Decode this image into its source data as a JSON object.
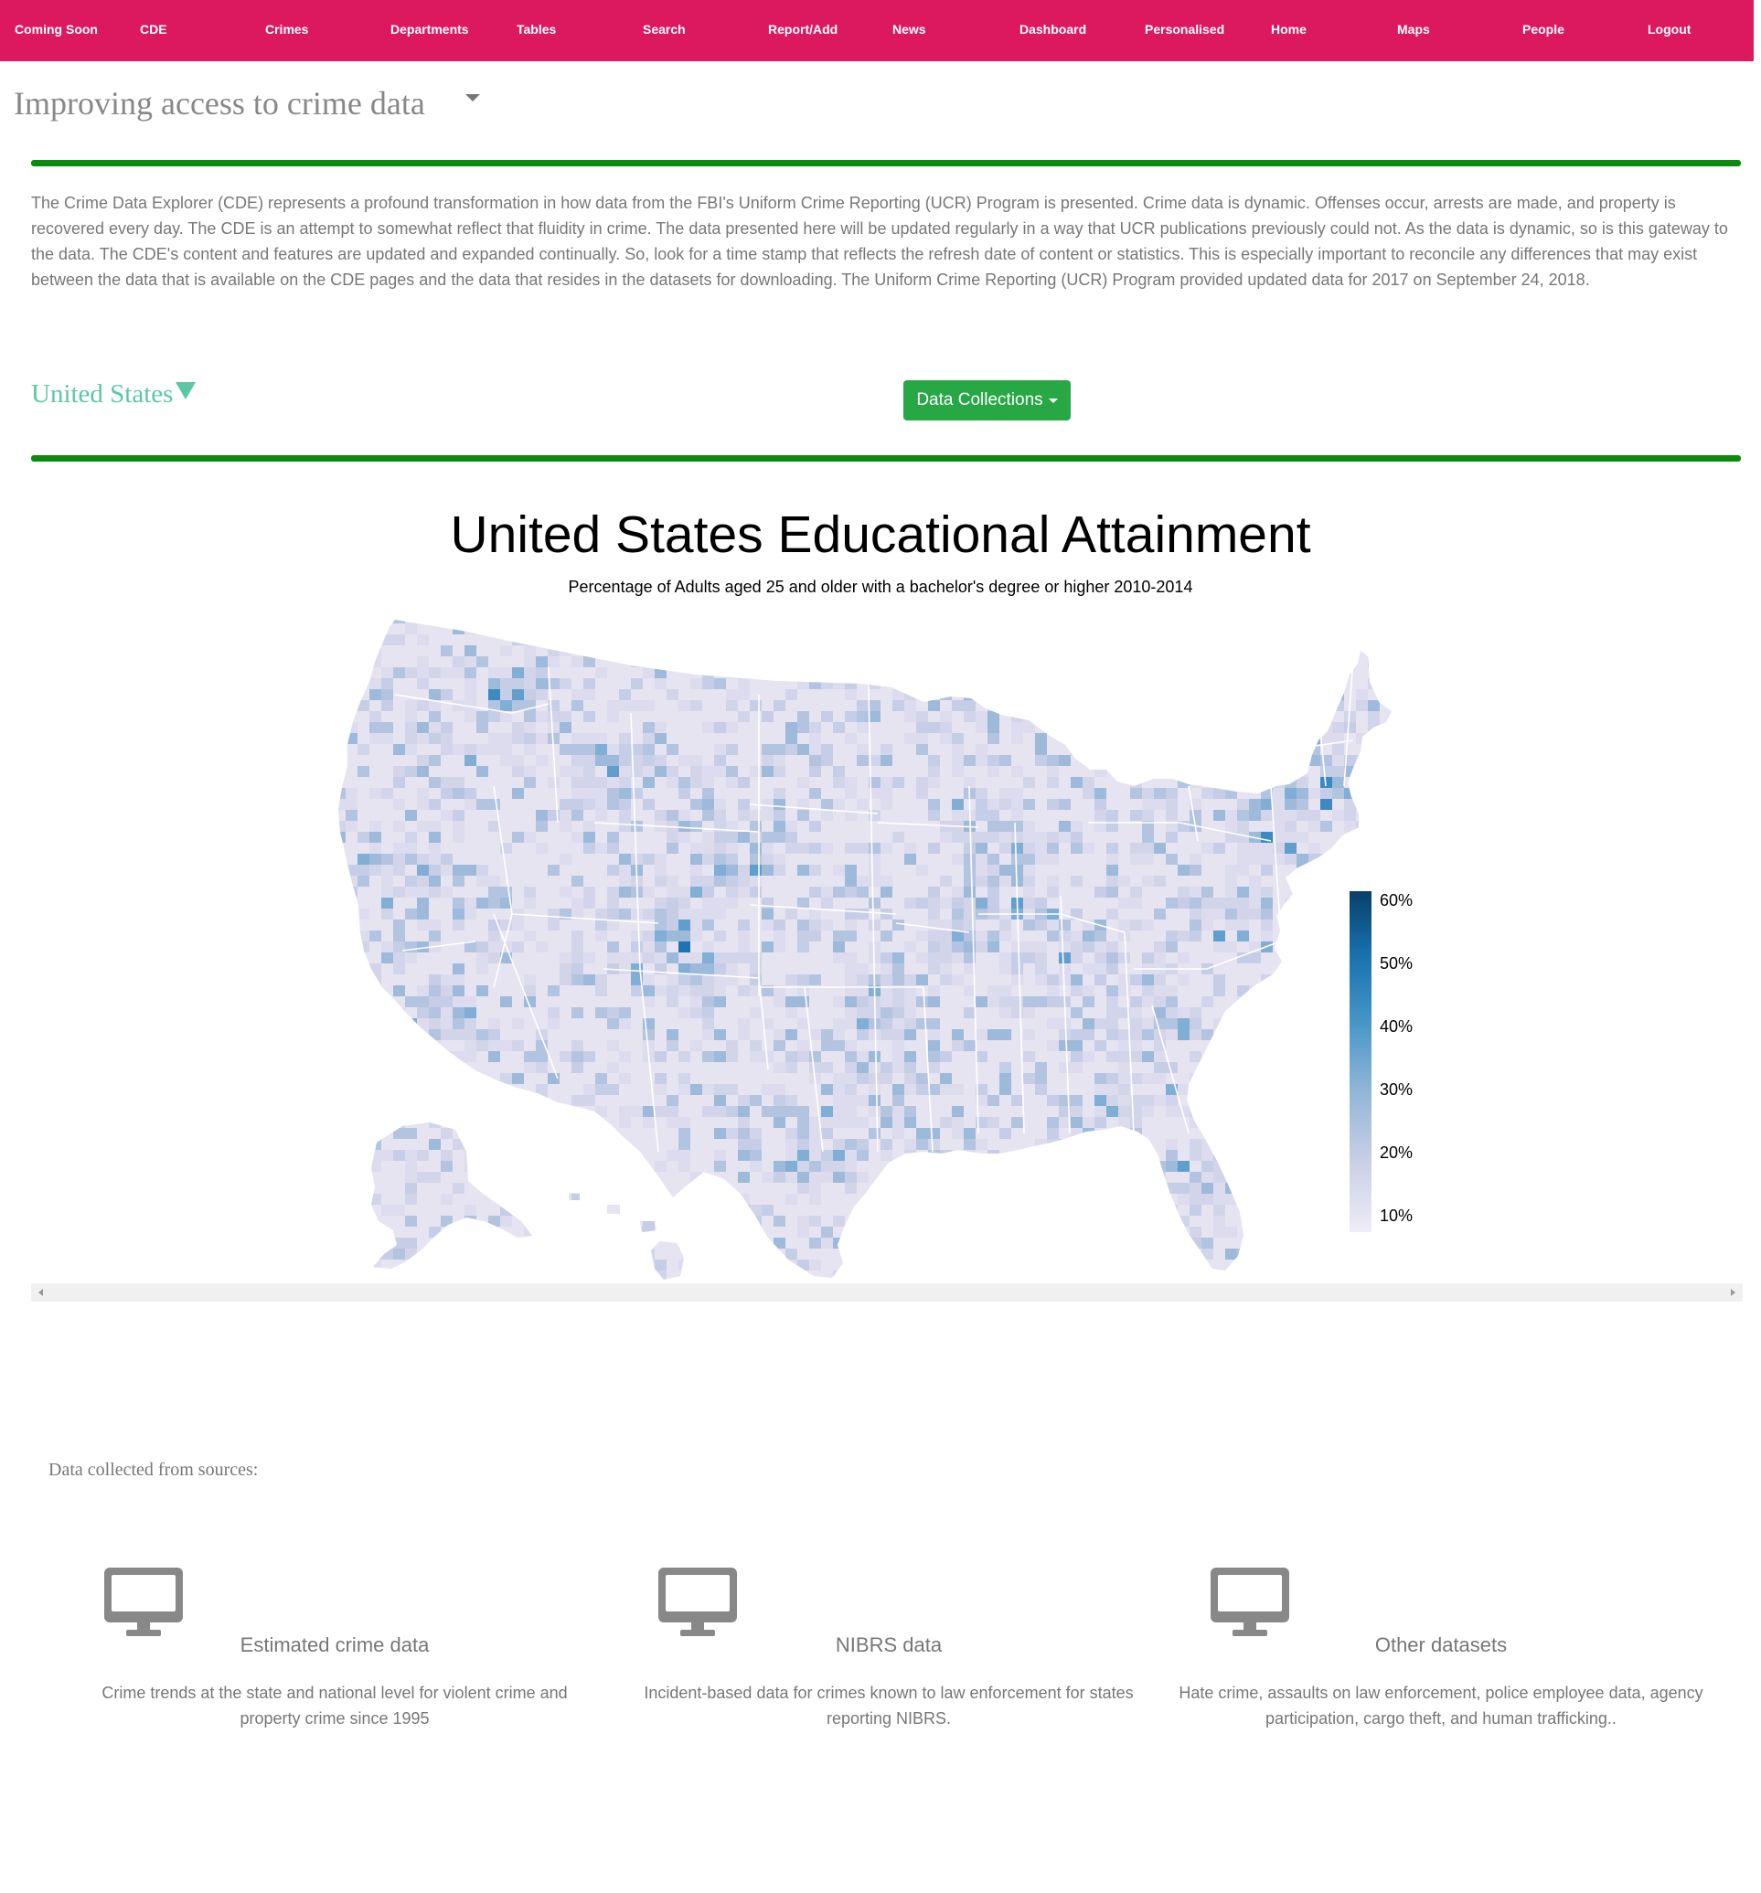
{
  "nav": {
    "items": [
      "Coming Soon",
      "CDE",
      "Crimes",
      "Departments",
      "Tables",
      "Search",
      "Report/Add",
      "News",
      "Dashboard",
      "Personalised",
      "Home",
      "Maps",
      "People",
      "Logout"
    ]
  },
  "header": {
    "title": "Improving access to crime data",
    "intro": "The Crime Data Explorer (CDE) represents a profound transformation in how data from the FBI's Uniform Crime Reporting (UCR) Program is presented. Crime data is dynamic. Offenses occur, arrests are made, and property is recovered every day. The CDE is an attempt to somewhat reflect that fluidity in crime. The data presented here will be updated regularly in a way that UCR publications previously could not. As the data is dynamic, so is this gateway to the data. The CDE's content and features are updated and expanded continually. So, look for a time stamp that reflects the refresh date of content or statistics. This is especially important to reconcile any differences that may exist between the data that is available on the CDE pages and the data that resides in the datasets for downloading. The Uniform Crime Reporting (UCR) Program provided updated data for 2017 on September 24, 2018."
  },
  "controls": {
    "region": "United States",
    "collections_button": "Data Collections"
  },
  "colors": {
    "nav_bg": "#dc195f",
    "rule": "#0b8a0b",
    "region_text": "#5cc7a4",
    "button_bg": "#28a745",
    "scale_low": "#e9e8f3",
    "scale_high": "#08426b"
  },
  "chart_data": {
    "type": "heatmap",
    "title": "United States Educational Attainment",
    "subtitle": "Percentage of Adults aged 25 and older with a bachelor's degree or higher 2010-2014",
    "colorbar": {
      "ticks": [
        "60%",
        "50%",
        "40%",
        "30%",
        "20%",
        "10%"
      ],
      "range": [
        7,
        62
      ],
      "unit": "%"
    },
    "regions": [
      "Alaska",
      "Hawaii",
      "contiguous United States"
    ]
  },
  "sources": {
    "heading": "Data collected from sources:",
    "cards": [
      {
        "icon": "monitor-icon",
        "title": "Estimated crime data",
        "description": "Crime trends at the state and national level for violent crime and property crime since 1995"
      },
      {
        "icon": "monitor-icon",
        "title": "NIBRS data",
        "description": "Incident-based data for crimes known to law enforcement for states reporting NIBRS."
      },
      {
        "icon": "monitor-icon",
        "title": "Other datasets",
        "description": "Hate crime, assaults on law enforcement, police employee data, agency participation, cargo theft, and human trafficking.."
      }
    ]
  }
}
